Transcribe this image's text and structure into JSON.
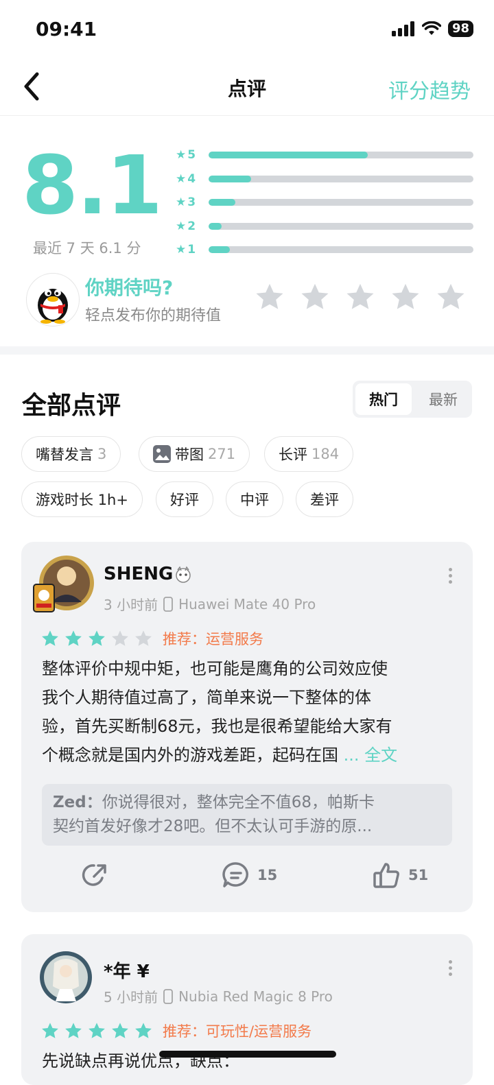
{
  "status_bar": {
    "time": "09:41",
    "battery": "98"
  },
  "nav": {
    "title": "点评",
    "trend_link": "评分趋势"
  },
  "score": {
    "value": "8.1",
    "recent_label": "最近 7 天 6.1 分",
    "distribution": [
      {
        "stars": "5",
        "fraction": 0.6
      },
      {
        "stars": "4",
        "fraction": 0.16
      },
      {
        "stars": "3",
        "fraction": 0.1
      },
      {
        "stars": "2",
        "fraction": 0.05
      },
      {
        "stars": "1",
        "fraction": 0.08
      }
    ]
  },
  "expect": {
    "title": "你期待吗?",
    "subtitle": "轻点发布你的期待值"
  },
  "reviews_section": {
    "title": "全部点评",
    "sort_hot": "热门",
    "sort_new": "最新",
    "filters": [
      {
        "label": "嘴替发言",
        "count": "3"
      },
      {
        "label": "带图",
        "count": "271",
        "icon": "image-icon"
      },
      {
        "label": "长评",
        "count": "184"
      },
      {
        "label": "游戏时长 1h+",
        "count": ""
      },
      {
        "label": "好评",
        "count": ""
      },
      {
        "label": "中评",
        "count": ""
      },
      {
        "label": "差评",
        "count": ""
      }
    ]
  },
  "reviews": [
    {
      "username": "SHENG",
      "time": "3 小时前",
      "device": "Huawei Mate 40 Pro",
      "rating": 3,
      "recommend": "推荐：运营服务",
      "body_lines": [
        "整体评价中规中矩，也可能是鹰角的公司效应使",
        "我个人期待值过高了，简单来说一下整体的体",
        "验，首先买断制68元，我也是很希望能给大家有",
        "个概念就是国内外的游戏差距，起码在国"
      ],
      "more": "... 全文",
      "reply_name": "Zed：",
      "reply_lines": [
        "你说得很对，整体完全不值68，帕斯卡",
        "契约首发好像才28吧。但不太认可手游的原..."
      ],
      "comments": "15",
      "likes": "51"
    },
    {
      "username": "*年 ¥",
      "time": "5 小时前",
      "device": "Nubia Red Magic 8 Pro",
      "rating": 5,
      "recommend": "推荐：可玩性/运营服务",
      "body_preview": "先说缺点再说优点，缺点："
    }
  ],
  "colors": {
    "accent": "#5fd3c4",
    "orange": "#f27a4a",
    "star_off": "#d3d6da"
  }
}
